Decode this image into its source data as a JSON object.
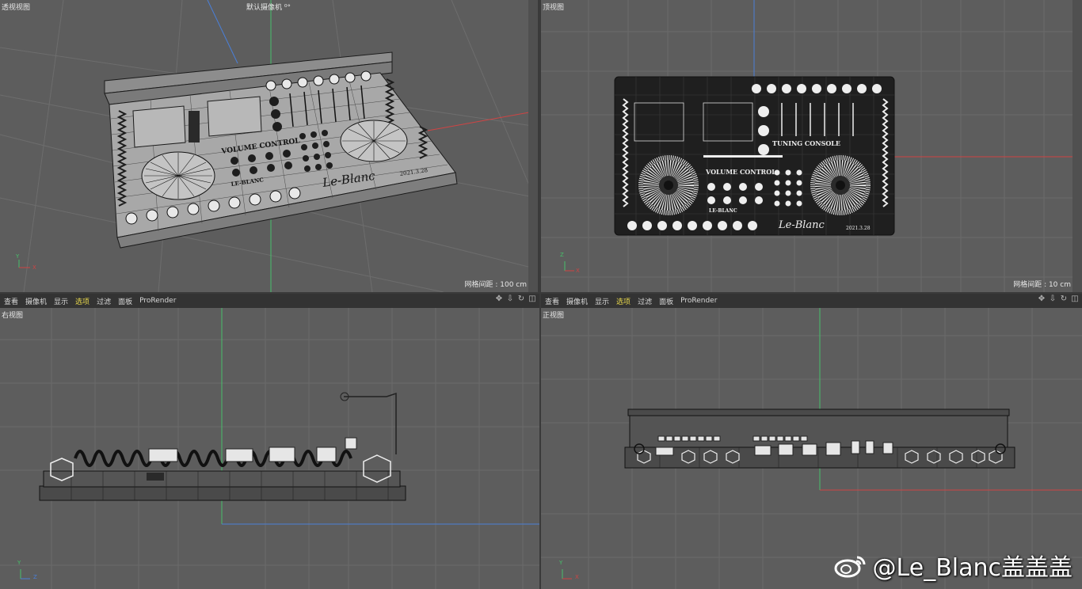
{
  "viewports": {
    "perspective": {
      "label": "透视视图",
      "camera": "默认摄像机 ⁰°",
      "grid": "网格间距 : 100 cm"
    },
    "top": {
      "label": "顶视图",
      "grid": "网格间距 : 10 cm"
    },
    "right": {
      "label": "右视图"
    },
    "front": {
      "label": "正视图"
    }
  },
  "menu": {
    "items": [
      "查看",
      "摄像机",
      "显示",
      "选项",
      "过滤",
      "面板",
      "ProRender"
    ],
    "active": "选项"
  },
  "model_text": {
    "tuning_console": "TUNING CONSOLE",
    "volume_control": "VOLUME CONTROL",
    "le_blanc_small": "LE-BLANC",
    "signature": "Le-Blanc",
    "date": "2021.3.28"
  },
  "axes": {
    "x": "X",
    "y": "Y",
    "z": "Z"
  },
  "watermark": "@Le_Blanc盖盖盖",
  "colors": {
    "viewport_bg": "#5d5d5d",
    "grid_line": "#6a6a6a",
    "axis_green": "#47c06a",
    "axis_red": "#d04444",
    "axis_blue": "#4a7fd8",
    "menu_active": "#e8d84c"
  }
}
